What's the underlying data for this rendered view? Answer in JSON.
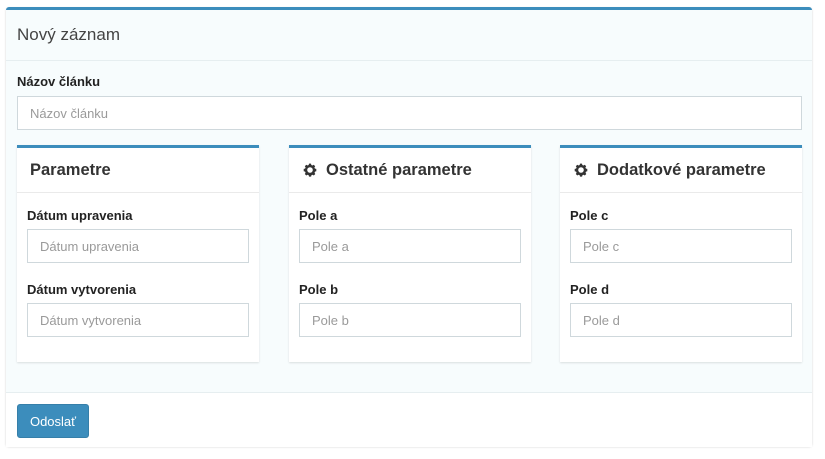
{
  "card": {
    "title": "Nový záznam"
  },
  "article_name": {
    "label": "Názov článku",
    "placeholder": "Názov článku",
    "value": ""
  },
  "panels": [
    {
      "title": "Parametre",
      "icon": null,
      "fields": [
        {
          "label": "Dátum upravenia",
          "placeholder": "Dátum upravenia",
          "value": ""
        },
        {
          "label": "Dátum vytvorenia",
          "placeholder": "Dátum vytvorenia",
          "value": ""
        }
      ]
    },
    {
      "title": "Ostatné parametre",
      "icon": "gear-icon",
      "fields": [
        {
          "label": "Pole a",
          "placeholder": "Pole a",
          "value": ""
        },
        {
          "label": "Pole b",
          "placeholder": "Pole b",
          "value": ""
        }
      ]
    },
    {
      "title": "Dodatkové parametre",
      "icon": "gear-icon",
      "fields": [
        {
          "label": "Pole c",
          "placeholder": "Pole c",
          "value": ""
        },
        {
          "label": "Pole d",
          "placeholder": "Pole d",
          "value": ""
        }
      ]
    }
  ],
  "footer": {
    "submit_label": "Odoslať"
  },
  "colors": {
    "accent": "#3c8dbc",
    "card_background": "#f7fcfd"
  }
}
